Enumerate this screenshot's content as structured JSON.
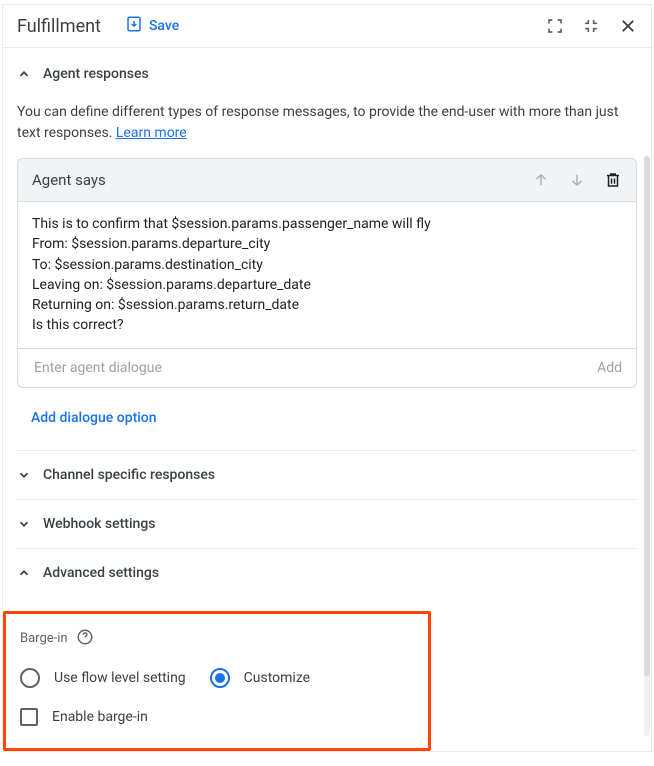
{
  "header": {
    "title": "Fulfillment",
    "save_label": "Save"
  },
  "sections": {
    "agent_responses": {
      "title": "Agent responses",
      "description": "You can define different types of response messages, to provide the end-user with more than just text responses. ",
      "learn_more": "Learn more"
    },
    "channel": {
      "title": "Channel specific responses"
    },
    "webhook": {
      "title": "Webhook settings"
    },
    "advanced": {
      "title": "Advanced settings"
    }
  },
  "card": {
    "title": "Agent says",
    "body": "This is to confirm that $session.params.passenger_name will fly\nFrom: $session.params.departure_city\nTo: $session.params.destination_city\nLeaving on: $session.params.departure_date\nReturning on: $session.params.return_date\nIs this correct?",
    "input_placeholder": "Enter agent dialogue",
    "add_label": "Add"
  },
  "add_dialogue_option": "Add dialogue option",
  "barge": {
    "label": "Barge-in",
    "flow_level": "Use flow level setting",
    "customize": "Customize",
    "enable": "Enable barge-in"
  }
}
